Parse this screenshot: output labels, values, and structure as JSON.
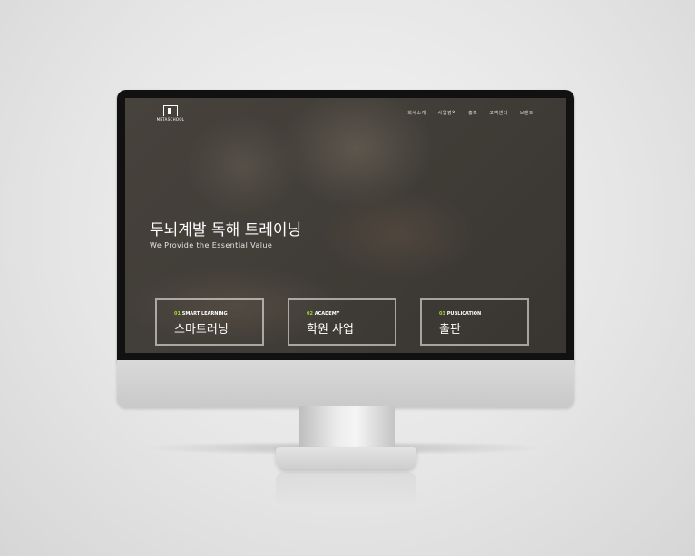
{
  "logo": {
    "text": "METASCHOOL"
  },
  "nav": {
    "items": [
      "회사소개",
      "사업영역",
      "홍보",
      "고객센터",
      "브랜드"
    ]
  },
  "hero": {
    "title": "두뇌계발 독해 트레이닝",
    "subtitle": "We Provide the Essential Value"
  },
  "cards": [
    {
      "num": "01",
      "tag": "SMART LEARNING",
      "title": "스마트러닝"
    },
    {
      "num": "02",
      "tag": "ACADEMY",
      "title": "학원 사업"
    },
    {
      "num": "03",
      "tag": "PUBLICATION",
      "title": "출판"
    }
  ],
  "colors": {
    "accent": "#a6d13b",
    "bezel": "#111111"
  }
}
